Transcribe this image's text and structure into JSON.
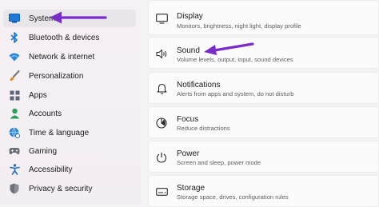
{
  "sidebar": {
    "items": [
      {
        "label": "System",
        "icon": "monitor-icon",
        "selected": true
      },
      {
        "label": "Bluetooth & devices",
        "icon": "bluetooth-icon"
      },
      {
        "label": "Network & internet",
        "icon": "wifi-icon"
      },
      {
        "label": "Personalization",
        "icon": "brush-icon"
      },
      {
        "label": "Apps",
        "icon": "apps-icon"
      },
      {
        "label": "Accounts",
        "icon": "person-icon"
      },
      {
        "label": "Time & language",
        "icon": "globe-clock-icon"
      },
      {
        "label": "Gaming",
        "icon": "gamepad-icon"
      },
      {
        "label": "Accessibility",
        "icon": "accessibility-icon"
      },
      {
        "label": "Privacy & security",
        "icon": "shield-icon"
      }
    ]
  },
  "main": {
    "cards": [
      {
        "title": "Display",
        "subtitle": "Monitors, brightness, night light, display profile",
        "icon": "display-icon"
      },
      {
        "title": "Sound",
        "subtitle": "Volume levels, output, input, sound devices",
        "icon": "speaker-icon"
      },
      {
        "title": "Notifications",
        "subtitle": "Alerts from apps and system, do not disturb",
        "icon": "bell-icon"
      },
      {
        "title": "Focus",
        "subtitle": "Reduce distractions",
        "icon": "focus-icon"
      },
      {
        "title": "Power",
        "subtitle": "Screen and sleep, power mode",
        "icon": "power-icon"
      },
      {
        "title": "Storage",
        "subtitle": "Storage space, drives, configuration rules",
        "icon": "storage-icon"
      }
    ]
  },
  "colors": {
    "accent": "#0067c0",
    "annotation_arrow": "#7a2cc9",
    "selected_bg": "#e9e6ea"
  }
}
